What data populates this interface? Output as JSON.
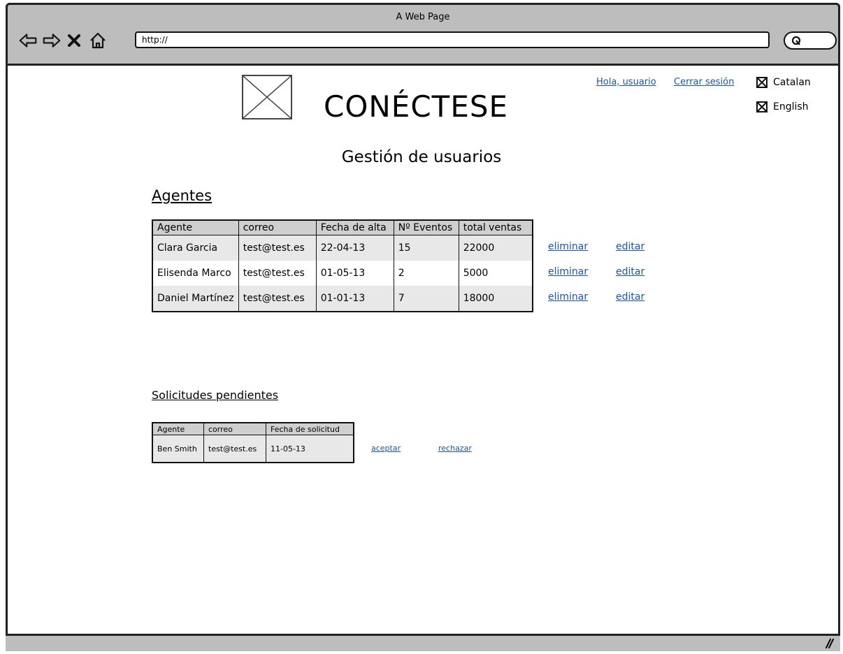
{
  "window": {
    "title": "A Web Page",
    "url": "http://"
  },
  "nav_icons": [
    "back-arrow-icon",
    "forward-arrow-icon",
    "stop-x-icon",
    "home-icon",
    "search-icon"
  ],
  "header": {
    "brand": "CONÉCTESE",
    "user_link": "Hola, usuario",
    "logout_link": "Cerrar sesión",
    "languages": [
      "Catalan",
      "English"
    ]
  },
  "page": {
    "subtitle": "Gestión de usuarios"
  },
  "agentes": {
    "heading": "Agentes",
    "columns": [
      "Agente",
      "correo",
      "Fecha de alta",
      "Nº Eventos",
      "total ventas"
    ],
    "rows": [
      {
        "agente": "Clara Garcia",
        "correo": "test@test.es",
        "fecha": "22-04-13",
        "eventos": "15",
        "ventas": "22000"
      },
      {
        "agente": "Elisenda Marco",
        "correo": "test@test.es",
        "fecha": "01-05-13",
        "eventos": "2",
        "ventas": "5000"
      },
      {
        "agente": "Daniel Martínez",
        "correo": "test@test.es",
        "fecha": "01-01-13",
        "eventos": "7",
        "ventas": "18000"
      }
    ],
    "delete_label": "eliminar",
    "edit_label": "editar"
  },
  "solicitudes": {
    "heading": "Solicitudes pendientes",
    "columns": [
      "Agente",
      "correo",
      "Fecha de solicitud"
    ],
    "rows": [
      {
        "agente": "Ben Smith",
        "correo": "test@test.es",
        "fecha": "11-05-13"
      }
    ],
    "accept_label": "aceptar",
    "reject_label": "rechazar"
  },
  "colors": {
    "link": "#1a56a8",
    "chrome": "#bdbdbd",
    "table_header": "#cfcfcf",
    "row_shade": "#e8e8e8"
  }
}
